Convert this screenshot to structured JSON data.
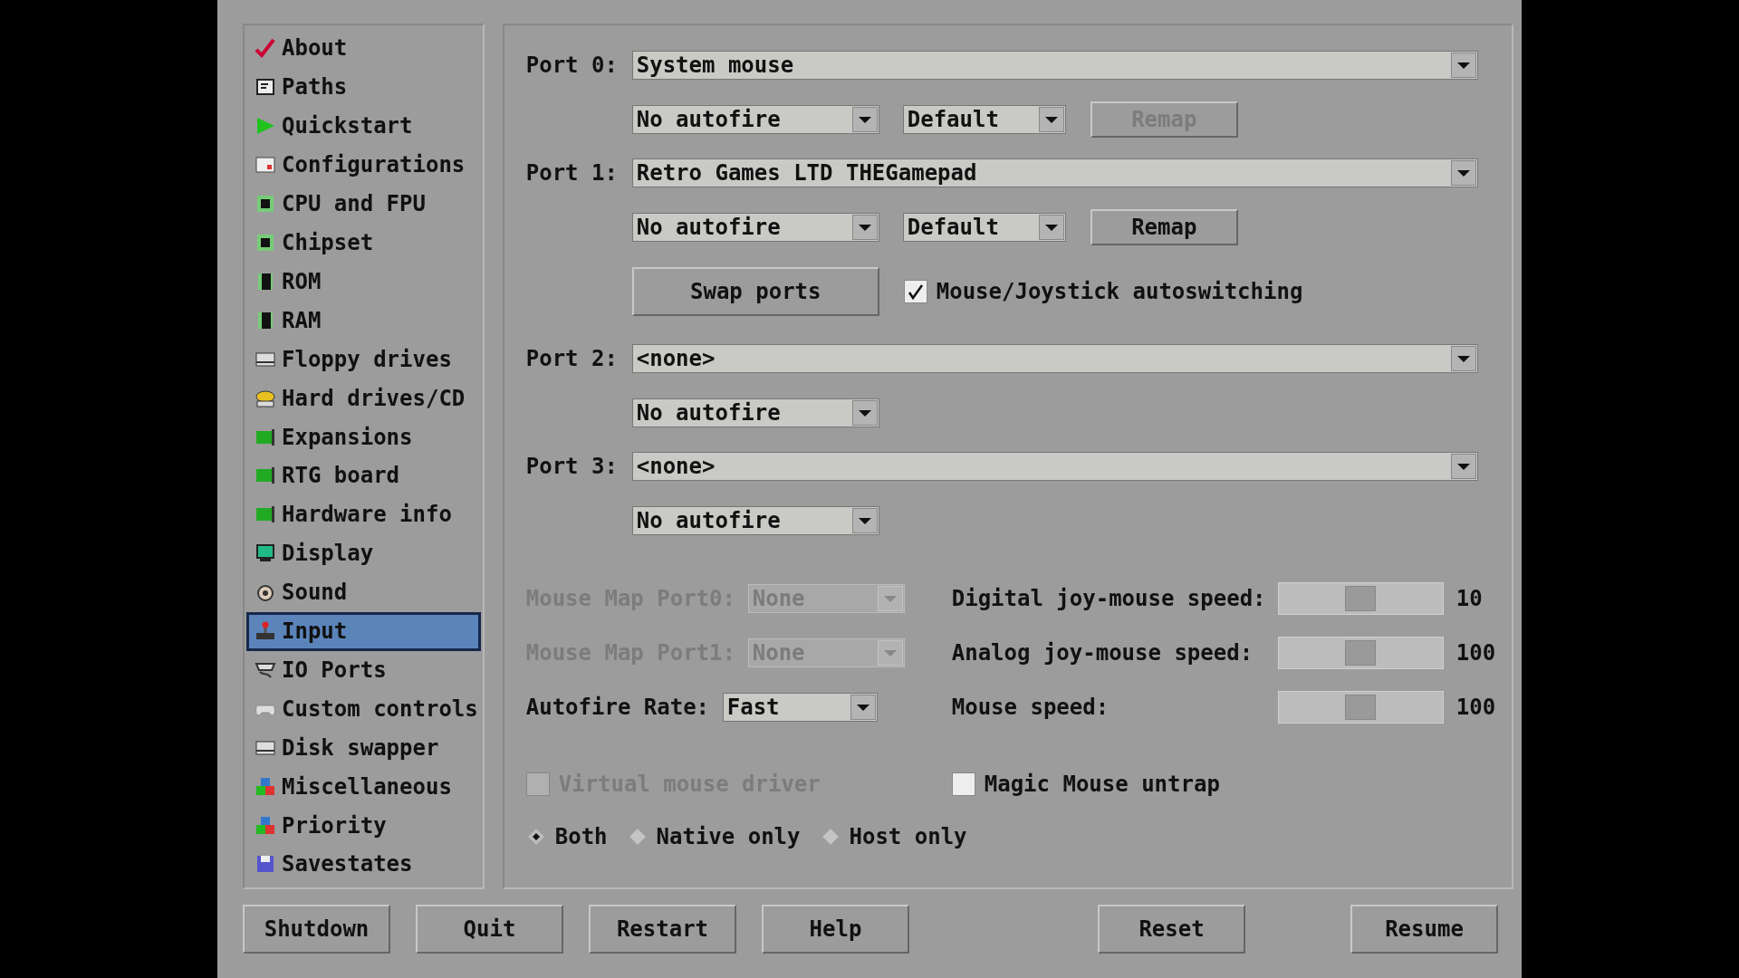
{
  "sidebar": {
    "items": [
      {
        "label": "About",
        "selected": false
      },
      {
        "label": "Paths",
        "selected": false
      },
      {
        "label": "Quickstart",
        "selected": false
      },
      {
        "label": "Configurations",
        "selected": false
      },
      {
        "label": "CPU and FPU",
        "selected": false
      },
      {
        "label": "Chipset",
        "selected": false
      },
      {
        "label": "ROM",
        "selected": false
      },
      {
        "label": "RAM",
        "selected": false
      },
      {
        "label": "Floppy drives",
        "selected": false
      },
      {
        "label": "Hard drives/CD",
        "selected": false
      },
      {
        "label": "Expansions",
        "selected": false
      },
      {
        "label": "RTG board",
        "selected": false
      },
      {
        "label": "Hardware info",
        "selected": false
      },
      {
        "label": "Display",
        "selected": false
      },
      {
        "label": "Sound",
        "selected": false
      },
      {
        "label": "Input",
        "selected": true
      },
      {
        "label": "IO Ports",
        "selected": false
      },
      {
        "label": "Custom controls",
        "selected": false
      },
      {
        "label": "Disk swapper",
        "selected": false
      },
      {
        "label": "Miscellaneous",
        "selected": false
      },
      {
        "label": "Priority",
        "selected": false
      },
      {
        "label": "Savestates",
        "selected": false
      }
    ]
  },
  "ports": [
    {
      "label": "Port 0:",
      "device": "System mouse",
      "autofire": "No autofire",
      "mode": "Default",
      "remap": {
        "label": "Remap",
        "disabled": true
      }
    },
    {
      "label": "Port 1:",
      "device": "Retro Games LTD THEGamepad",
      "autofire": "No autofire",
      "mode": "Default",
      "remap": {
        "label": "Remap",
        "disabled": false
      },
      "swap_button": "Swap ports",
      "autoswitch": {
        "label": "Mouse/Joystick autoswitching",
        "checked": true
      }
    },
    {
      "label": "Port 2:",
      "device": "<none>",
      "autofire": "No autofire"
    },
    {
      "label": "Port 3:",
      "device": "<none>",
      "autofire": "No autofire"
    }
  ],
  "options": [
    {
      "kind": "dropdown",
      "label": "Mouse Map Port0:",
      "value": "None",
      "disabled": true,
      "slider": {
        "label": "Digital joy-mouse speed:",
        "level": 0.5,
        "reading": "10"
      }
    },
    {
      "kind": "dropdown",
      "label": "Mouse Map Port1:",
      "value": "None",
      "disabled": true,
      "slider": {
        "label": "Analog joy-mouse speed:",
        "level": 0.5,
        "reading": "100"
      }
    },
    {
      "kind": "dropdown",
      "label": "Autofire Rate:",
      "value": "Fast",
      "disabled": false,
      "slider": {
        "label": "Mouse speed:",
        "level": 0.5,
        "reading": "100"
      }
    }
  ],
  "checkboxes": [
    {
      "label": "Virtual mouse driver",
      "checked": false,
      "disabled": true
    },
    {
      "label": "Magic Mouse untrap",
      "checked": false,
      "disabled": false
    }
  ],
  "radios": [
    {
      "label": "Both",
      "selected": true
    },
    {
      "label": "Native only",
      "selected": false
    },
    {
      "label": "Host only",
      "selected": false
    }
  ],
  "buttons_left": [
    "Shutdown",
    "Quit",
    "Restart",
    "Help"
  ],
  "buttons_right": [
    "Reset",
    "Resume"
  ]
}
